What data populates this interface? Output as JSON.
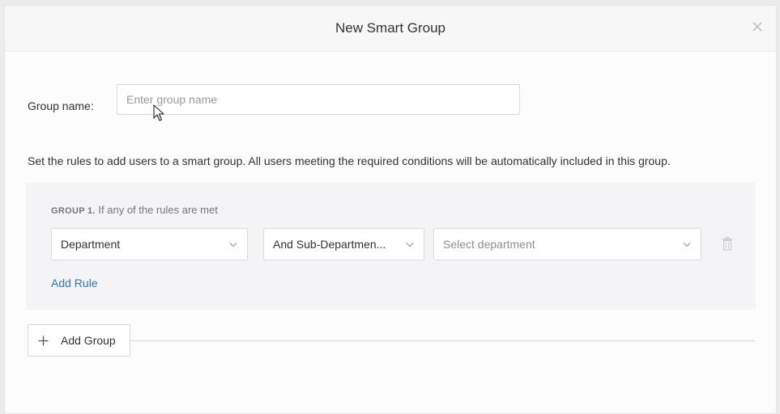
{
  "modal": {
    "title": "New Smart Group",
    "close_icon": "close-icon"
  },
  "group_name": {
    "label": "Group name:",
    "value": "",
    "placeholder": "Enter group name"
  },
  "description": "Set the rules to add users to a smart group. All users meeting the required conditions will be automatically included in this group.",
  "groups": [
    {
      "number_label": "GROUP 1.",
      "condition_text": "If any of the rules are met",
      "rules": [
        {
          "field": "Department",
          "operator": "And Sub-Departmen...",
          "value_placeholder": "Select department"
        }
      ],
      "add_rule_label": "Add Rule"
    }
  ],
  "add_group_label": "Add Group",
  "icons": {
    "chevron": "chevron-down-icon",
    "delete": "trash-icon",
    "add": "plus-icon",
    "pointer": "mouse-cursor-icon"
  },
  "colors": {
    "link": "#2b7ab3",
    "header_bg": "#f7f7f7",
    "group_bg": "#f4f4f6"
  }
}
